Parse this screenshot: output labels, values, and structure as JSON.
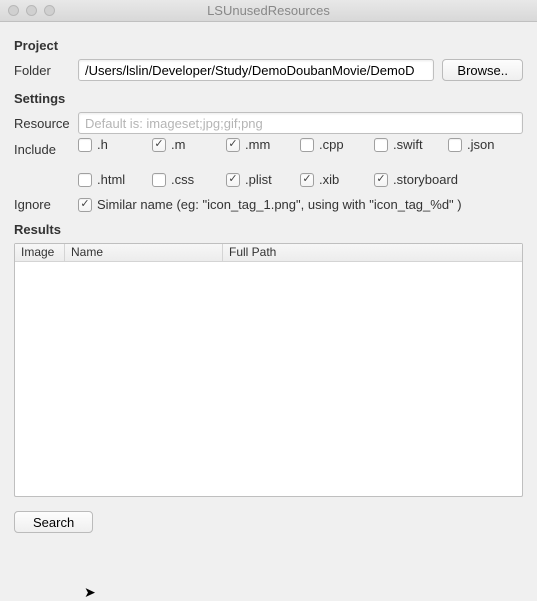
{
  "window": {
    "title": "LSUnusedResources"
  },
  "project": {
    "heading": "Project",
    "folder_label": "Folder",
    "folder_value": "/Users/lslin/Developer/Study/DemoDoubanMovie/DemoD",
    "browse_label": "Browse.."
  },
  "settings": {
    "heading": "Settings",
    "resource_label": "Resource",
    "resource_placeholder": "Default is: imageset;jpg;gif;png",
    "include_label": "Include",
    "include_items": [
      {
        "ext": ".h",
        "checked": false
      },
      {
        "ext": ".m",
        "checked": true
      },
      {
        "ext": ".mm",
        "checked": true
      },
      {
        "ext": ".cpp",
        "checked": false
      },
      {
        "ext": ".swift",
        "checked": false
      },
      {
        "ext": ".json",
        "checked": false
      },
      {
        "ext": ".html",
        "checked": false
      },
      {
        "ext": ".css",
        "checked": false
      },
      {
        "ext": ".plist",
        "checked": true
      },
      {
        "ext": ".xib",
        "checked": true
      },
      {
        "ext": ".storyboard",
        "checked": true
      }
    ],
    "ignore_label": "Ignore",
    "ignore_checked": true,
    "ignore_text": "Similar name (eg: \"icon_tag_1.png\", using with \"icon_tag_%d\" )"
  },
  "results": {
    "heading": "Results",
    "columns": {
      "image": "Image",
      "name": "Name",
      "fullpath": "Full Path"
    },
    "rows": []
  },
  "footer": {
    "search_label": "Search"
  }
}
